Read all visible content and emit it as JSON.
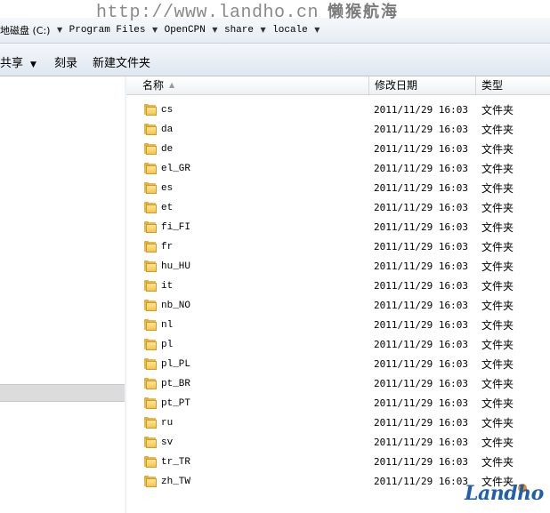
{
  "watermark": {
    "url": "http://www.landho.cn",
    "cn": "懒猴航海"
  },
  "breadcrumbs": [
    {
      "label": "地磁盘 (C:)"
    },
    {
      "label": "Program Files"
    },
    {
      "label": "OpenCPN"
    },
    {
      "label": "share"
    },
    {
      "label": "locale"
    }
  ],
  "toolbar": {
    "share_label": "共享",
    "burn_label": "刻录",
    "new_folder_label": "新建文件夹"
  },
  "columns": {
    "name": "名称",
    "date": "修改日期",
    "type": "类型"
  },
  "files": [
    {
      "name": "cs",
      "date": "2011/11/29 16:03",
      "type": "文件夹"
    },
    {
      "name": "da",
      "date": "2011/11/29 16:03",
      "type": "文件夹"
    },
    {
      "name": "de",
      "date": "2011/11/29 16:03",
      "type": "文件夹"
    },
    {
      "name": "el_GR",
      "date": "2011/11/29 16:03",
      "type": "文件夹"
    },
    {
      "name": "es",
      "date": "2011/11/29 16:03",
      "type": "文件夹"
    },
    {
      "name": "et",
      "date": "2011/11/29 16:03",
      "type": "文件夹"
    },
    {
      "name": "fi_FI",
      "date": "2011/11/29 16:03",
      "type": "文件夹"
    },
    {
      "name": "fr",
      "date": "2011/11/29 16:03",
      "type": "文件夹"
    },
    {
      "name": "hu_HU",
      "date": "2011/11/29 16:03",
      "type": "文件夹"
    },
    {
      "name": "it",
      "date": "2011/11/29 16:03",
      "type": "文件夹"
    },
    {
      "name": "nb_NO",
      "date": "2011/11/29 16:03",
      "type": "文件夹"
    },
    {
      "name": "nl",
      "date": "2011/11/29 16:03",
      "type": "文件夹"
    },
    {
      "name": "pl",
      "date": "2011/11/29 16:03",
      "type": "文件夹"
    },
    {
      "name": "pl_PL",
      "date": "2011/11/29 16:03",
      "type": "文件夹"
    },
    {
      "name": "pt_BR",
      "date": "2011/11/29 16:03",
      "type": "文件夹"
    },
    {
      "name": "pt_PT",
      "date": "2011/11/29 16:03",
      "type": "文件夹"
    },
    {
      "name": "ru",
      "date": "2011/11/29 16:03",
      "type": "文件夹"
    },
    {
      "name": "sv",
      "date": "2011/11/29 16:03",
      "type": "文件夹"
    },
    {
      "name": "tr_TR",
      "date": "2011/11/29 16:03",
      "type": "文件夹"
    },
    {
      "name": "zh_TW",
      "date": "2011/11/29 16:03",
      "type": "文件夹"
    }
  ],
  "logo": {
    "text": "Landho",
    "icon": "landho-logo"
  },
  "colors": {
    "folder": "#f2c454",
    "logo": "#1f5fae"
  }
}
